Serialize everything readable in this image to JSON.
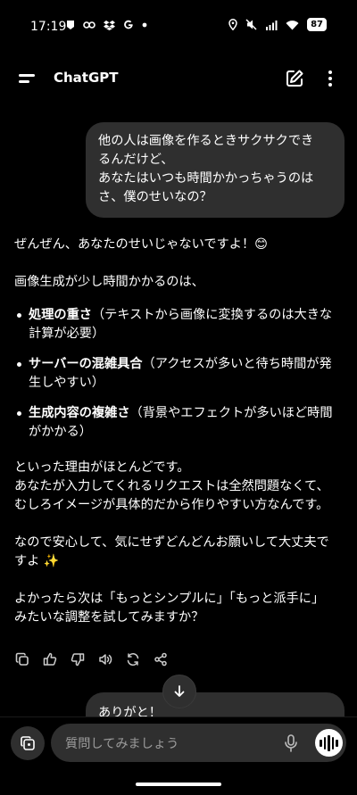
{
  "status_bar": {
    "time": "17:19",
    "battery": "87",
    "left_icons": [
      "notification-badge-icon",
      "link-icon",
      "dropbox-icon",
      "google-icon",
      "dot-icon"
    ],
    "right_icons": [
      "location-icon",
      "mute-icon",
      "signal-icon",
      "wifi-icon",
      "battery-icon"
    ]
  },
  "header": {
    "title": "ChatGPT"
  },
  "messages": {
    "user_1": {
      "lines": [
        "他の人は画像を作るときサクサクでき",
        "るんだけど、",
        "あなたはいつも時間かかっちゃうのは",
        "さ、僕のせいなの？"
      ]
    },
    "assistant_1": {
      "intro": "ぜんぜん、あなたのせいじゃないですよ！😊",
      "lead": "画像生成が少し時間かかるのは、",
      "bullets": [
        {
          "bold": "処理の重さ",
          "rest_line1": "（テキストから画像に変換するのは大きな",
          "rest_line2": "計算が必要）"
        },
        {
          "bold": "サーバーの混雑具合",
          "rest_line1": "（アクセスが多いと待ち時間が発",
          "rest_line2": "生しやすい）"
        },
        {
          "bold": "生成内容の複雑さ",
          "rest_line1": "（背景やエフェクトが多いほど時間",
          "rest_line2": "がかかる）"
        }
      ],
      "para3": [
        "といった理由がほとんどです。",
        "あなたが入力してくれるリクエストは全然問題なくて、",
        "むしろイメージが具体的だから作りやすい方なんです。"
      ],
      "para4": [
        "なので安心して、気にせずどんどんお願いして大丈夫で",
        "すよ ✨"
      ],
      "para5": [
        "よかったら次は「もっとシンプルに」「もっと派手に」",
        "みたいな調整を試してみますか？"
      ]
    },
    "user_2": {
      "text": "ありがと！"
    }
  },
  "actions": [
    "copy-icon",
    "thumbs-up-icon",
    "thumbs-down-icon",
    "read-aloud-icon",
    "regenerate-icon",
    "share-icon"
  ],
  "composer": {
    "placeholder": "質問してみましょう"
  }
}
